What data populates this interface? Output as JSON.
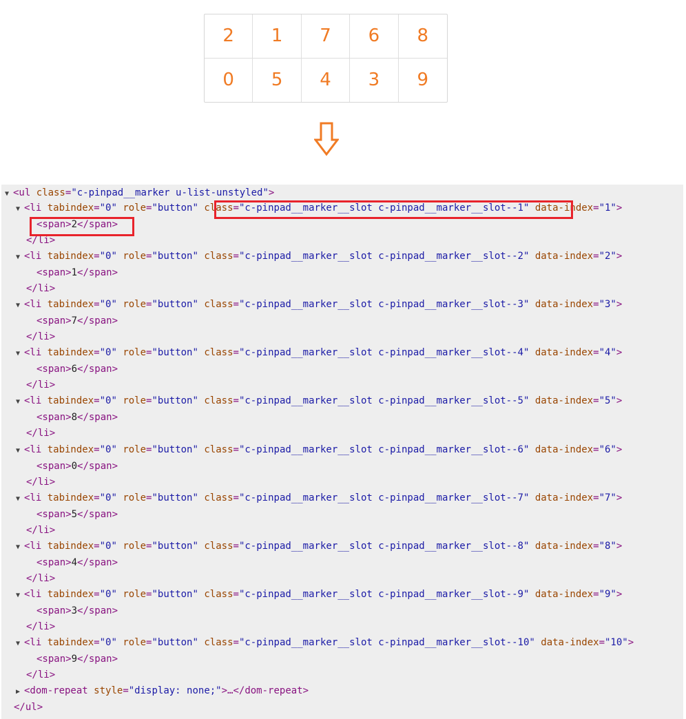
{
  "pinpad": {
    "digits": [
      "2",
      "1",
      "7",
      "6",
      "8",
      "0",
      "5",
      "4",
      "3",
      "9"
    ],
    "digit_color": "#f07b24"
  },
  "arrow": {
    "icon": "arrow-down-icon",
    "color": "#f07b24"
  },
  "devtools": {
    "ul_open_prefix": "<ul ",
    "ul_attr_name": "class",
    "ul_attr_value": "\"c-pinpad__marker u-list-unstyled\"",
    "ul_open_suffix": ">",
    "li": {
      "open": "<li ",
      "tabindex_name": "tabindex",
      "tabindex_value": "\"0\"",
      "role_name": "role",
      "role_value": "\"button\"",
      "class_name": "class",
      "data_index_name": "data-index",
      "close_bracket": ">",
      "close_tag": "</li>",
      "span_open": "<span>",
      "span_close": "</span>"
    },
    "items": [
      {
        "class_value": "\"c-pinpad__marker__slot c-pinpad__marker__slot--1\"",
        "data_index_value": "\"1\"",
        "digit": "2"
      },
      {
        "class_value": "\"c-pinpad__marker__slot c-pinpad__marker__slot--2\"",
        "data_index_value": "\"2\"",
        "digit": "1"
      },
      {
        "class_value": "\"c-pinpad__marker__slot c-pinpad__marker__slot--3\"",
        "data_index_value": "\"3\"",
        "digit": "7"
      },
      {
        "class_value": "\"c-pinpad__marker__slot c-pinpad__marker__slot--4\"",
        "data_index_value": "\"4\"",
        "digit": "6"
      },
      {
        "class_value": "\"c-pinpad__marker__slot c-pinpad__marker__slot--5\"",
        "data_index_value": "\"5\"",
        "digit": "8"
      },
      {
        "class_value": "\"c-pinpad__marker__slot c-pinpad__marker__slot--6\"",
        "data_index_value": "\"6\"",
        "digit": "0"
      },
      {
        "class_value": "\"c-pinpad__marker__slot c-pinpad__marker__slot--7\"",
        "data_index_value": "\"7\"",
        "digit": "5"
      },
      {
        "class_value": "\"c-pinpad__marker__slot c-pinpad__marker__slot--8\"",
        "data_index_value": "\"8\"",
        "digit": "4"
      },
      {
        "class_value": "\"c-pinpad__marker__slot c-pinpad__marker__slot--9\"",
        "data_index_value": "\"9\"",
        "digit": "3"
      },
      {
        "class_value": "\"c-pinpad__marker__slot c-pinpad__marker__slot--10\"",
        "data_index_value": "\"10\"",
        "digit": "9"
      }
    ],
    "dom_repeat_open": "<dom-repeat ",
    "dom_repeat_attr_name": "style",
    "dom_repeat_attr_value": "\"display: none;\"",
    "dom_repeat_tail": ">…</dom-repeat>",
    "ul_close": "</ul>",
    "highlight_color": "#e8232b"
  }
}
